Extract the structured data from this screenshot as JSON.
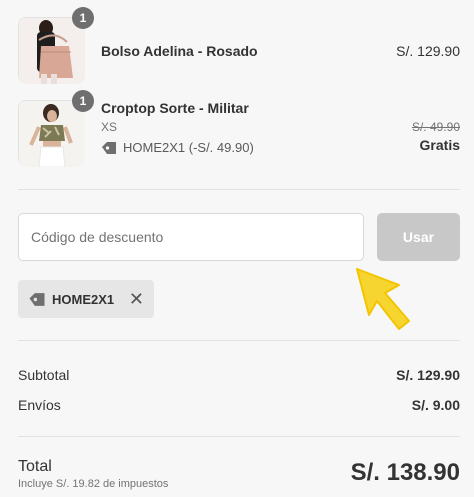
{
  "items": [
    {
      "quantity": "1",
      "name": "Bolso Adelina - Rosado",
      "price": "S/. 129.90",
      "image_icon": "product-bag-icon"
    },
    {
      "quantity": "1",
      "name": "Croptop Sorte - Militar",
      "variant": "XS",
      "discount_label": "HOME2X1 (-S/. 49.90)",
      "old_price": "S/. 49.90",
      "price": "Gratis",
      "image_icon": "product-croptop-icon"
    }
  ],
  "discount": {
    "placeholder": "Código de descuento",
    "value": "",
    "apply_label": "Usar",
    "applied_code": "HOME2X1",
    "remove_symbol": "✕"
  },
  "summary": {
    "subtotal_label": "Subtotal",
    "subtotal_value": "S/. 129.90",
    "shipping_label": "Envíos",
    "shipping_value": "S/. 9.00",
    "total_label": "Total",
    "tax_note": "Incluye S/. 19.82 de impuestos",
    "total_value": "S/. 138.90"
  },
  "colors": {
    "accent_cursor": "#f7d531",
    "button_disabled": "#c8c8c8"
  }
}
